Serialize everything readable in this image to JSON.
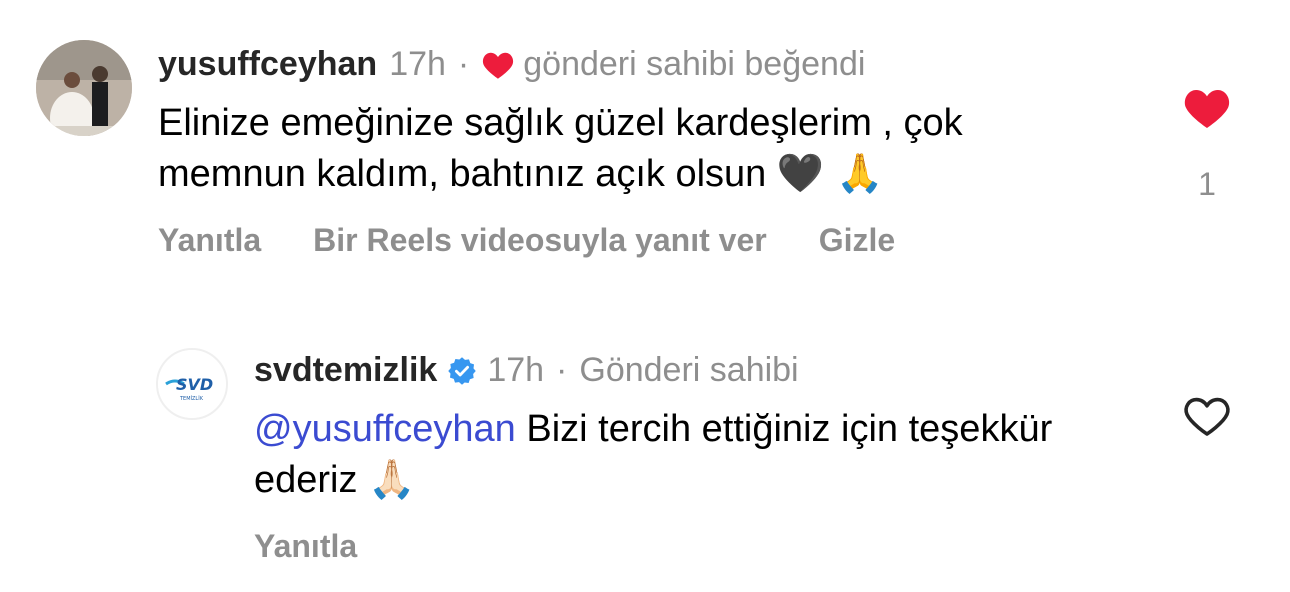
{
  "comments": [
    {
      "username": "yusuffceyhan",
      "time": "17h",
      "separator": "·",
      "liked_by_author_label": "gönderi sahibi beğendi",
      "text": "Elinize emeğinize sağlık güzel kardeşlerim , çok memnun kaldım, bahtınız açık olsun",
      "emojis": "🖤 🙏",
      "actions": [
        "Yanıtla",
        "Bir Reels videosuyla yanıt ver",
        "Gizle"
      ],
      "liked": true,
      "like_count": "1",
      "heart_color": "#ed1c3c"
    },
    {
      "username": "svdtemizlik",
      "verified": true,
      "time": "17h",
      "separator": "·",
      "badge_label": "Gönderi sahibi",
      "mention": "@yusuffceyhan",
      "text": "Bizi tercih ettiğiniz için teşekkür ederiz",
      "emojis": "🙏🏻",
      "actions": [
        "Yanıtla"
      ],
      "liked": false,
      "avatar_logo_text": "SVD",
      "avatar_logo_subtext": "TEMİZLİK"
    }
  ],
  "colors": {
    "mention": "#3b4bd1",
    "verified": "#3797f0",
    "muted": "#8e8e8e"
  }
}
